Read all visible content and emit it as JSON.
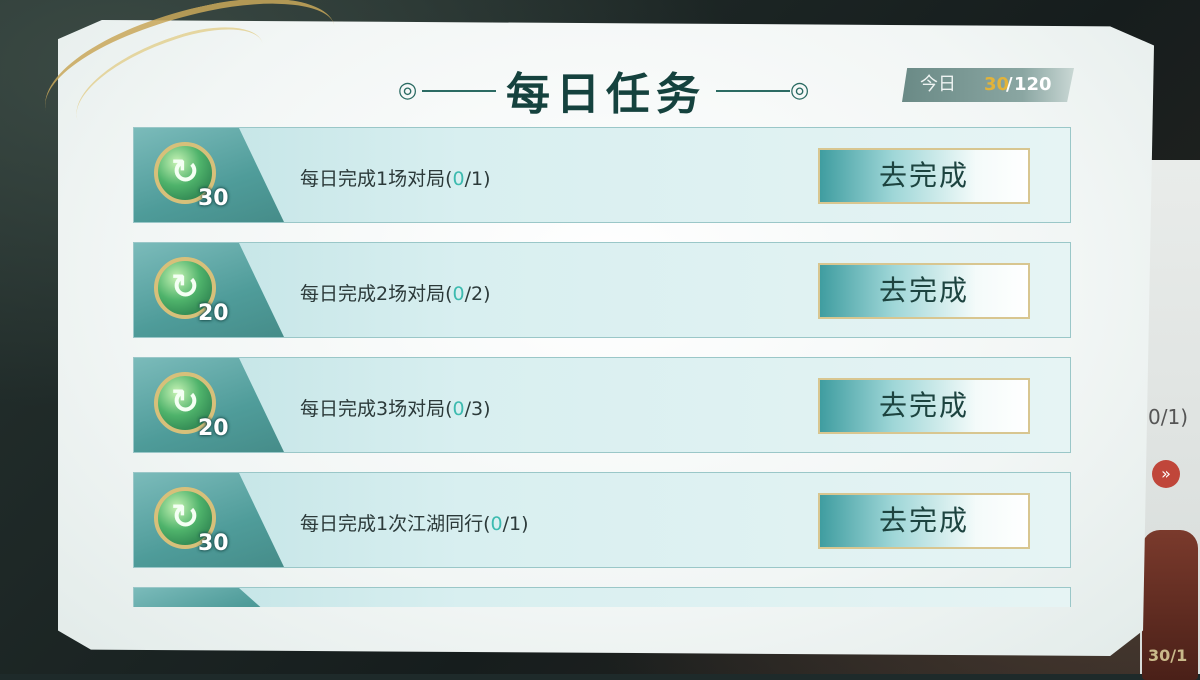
{
  "title": "每日任务",
  "today": {
    "label": "今日",
    "current": "30",
    "separator": "/",
    "max": "120"
  },
  "tasks": [
    {
      "points": "30",
      "desc_prefix": "每日完成1场对局(",
      "progress": "0",
      "desc_suffix": "/1)",
      "button": "去完成"
    },
    {
      "points": "20",
      "desc_prefix": "每日完成2场对局(",
      "progress": "0",
      "desc_suffix": "/2)",
      "button": "去完成"
    },
    {
      "points": "20",
      "desc_prefix": "每日完成3场对局(",
      "progress": "0",
      "desc_suffix": "/3)",
      "button": "去完成"
    },
    {
      "points": "30",
      "desc_prefix": "每日完成1次江湖同行(",
      "progress": "0",
      "desc_suffix": "/1)",
      "button": "去完成"
    }
  ],
  "background_peek": {
    "text": "0/1)",
    "bottom_text": "30/1"
  },
  "colors": {
    "title": "#15423e",
    "accent_gold": "#e2b33a",
    "progress": "#3dbbb0",
    "row_border": "#9ac7c8"
  },
  "icons": {
    "task_coin": "jade-swirl-coin-icon",
    "title_ornament": "cloud-swirl-icon"
  }
}
